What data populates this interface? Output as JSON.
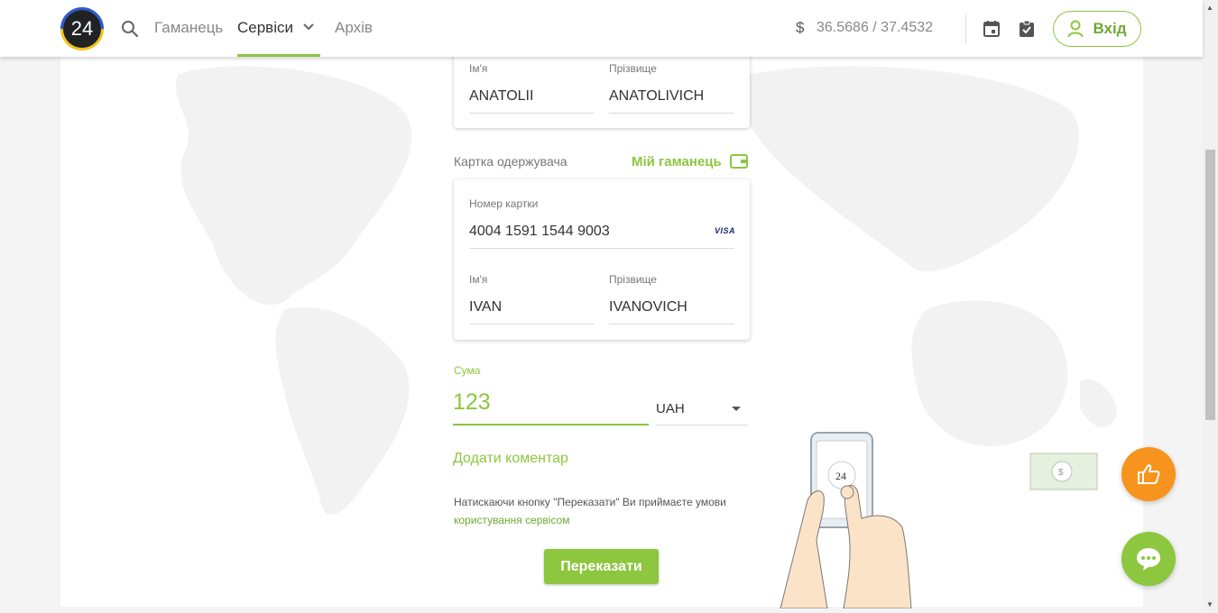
{
  "header": {
    "logo_text": "24",
    "nav": [
      {
        "label": "Гаманець"
      },
      {
        "label": "Сервіси"
      },
      {
        "label": "Архів"
      }
    ],
    "exchange_rate": "36.5686 / 37.4532",
    "currency_symbol": "$",
    "login_label": "Вхід"
  },
  "sender": {
    "first_name_label": "Ім'я",
    "first_name": "ANATOLII",
    "last_name_label": "Прізвище",
    "last_name": "ANATOLIVICH"
  },
  "recipient": {
    "section_label": "Картка одержувача",
    "wallet_link": "Мій гаманець",
    "card_number_label": "Номер картки",
    "card_number": "4004 1591 1544 9003",
    "card_brand": "VISA",
    "first_name_label": "Ім'я",
    "first_name": "IVAN",
    "last_name_label": "Прізвище",
    "last_name": "IVANOVICH"
  },
  "amount": {
    "label": "Сума",
    "value": "123",
    "currency": "UAH"
  },
  "add_comment": "Додати коментар",
  "terms": {
    "prefix": "Натискаючи кнопку \"Переказати\" Ви приймаєте умови",
    "link": "користування сервісом"
  },
  "transfer_button": "Переказати",
  "illustration_text": "24",
  "colors": {
    "accent": "#8dc63f",
    "like": "#f7941d"
  }
}
